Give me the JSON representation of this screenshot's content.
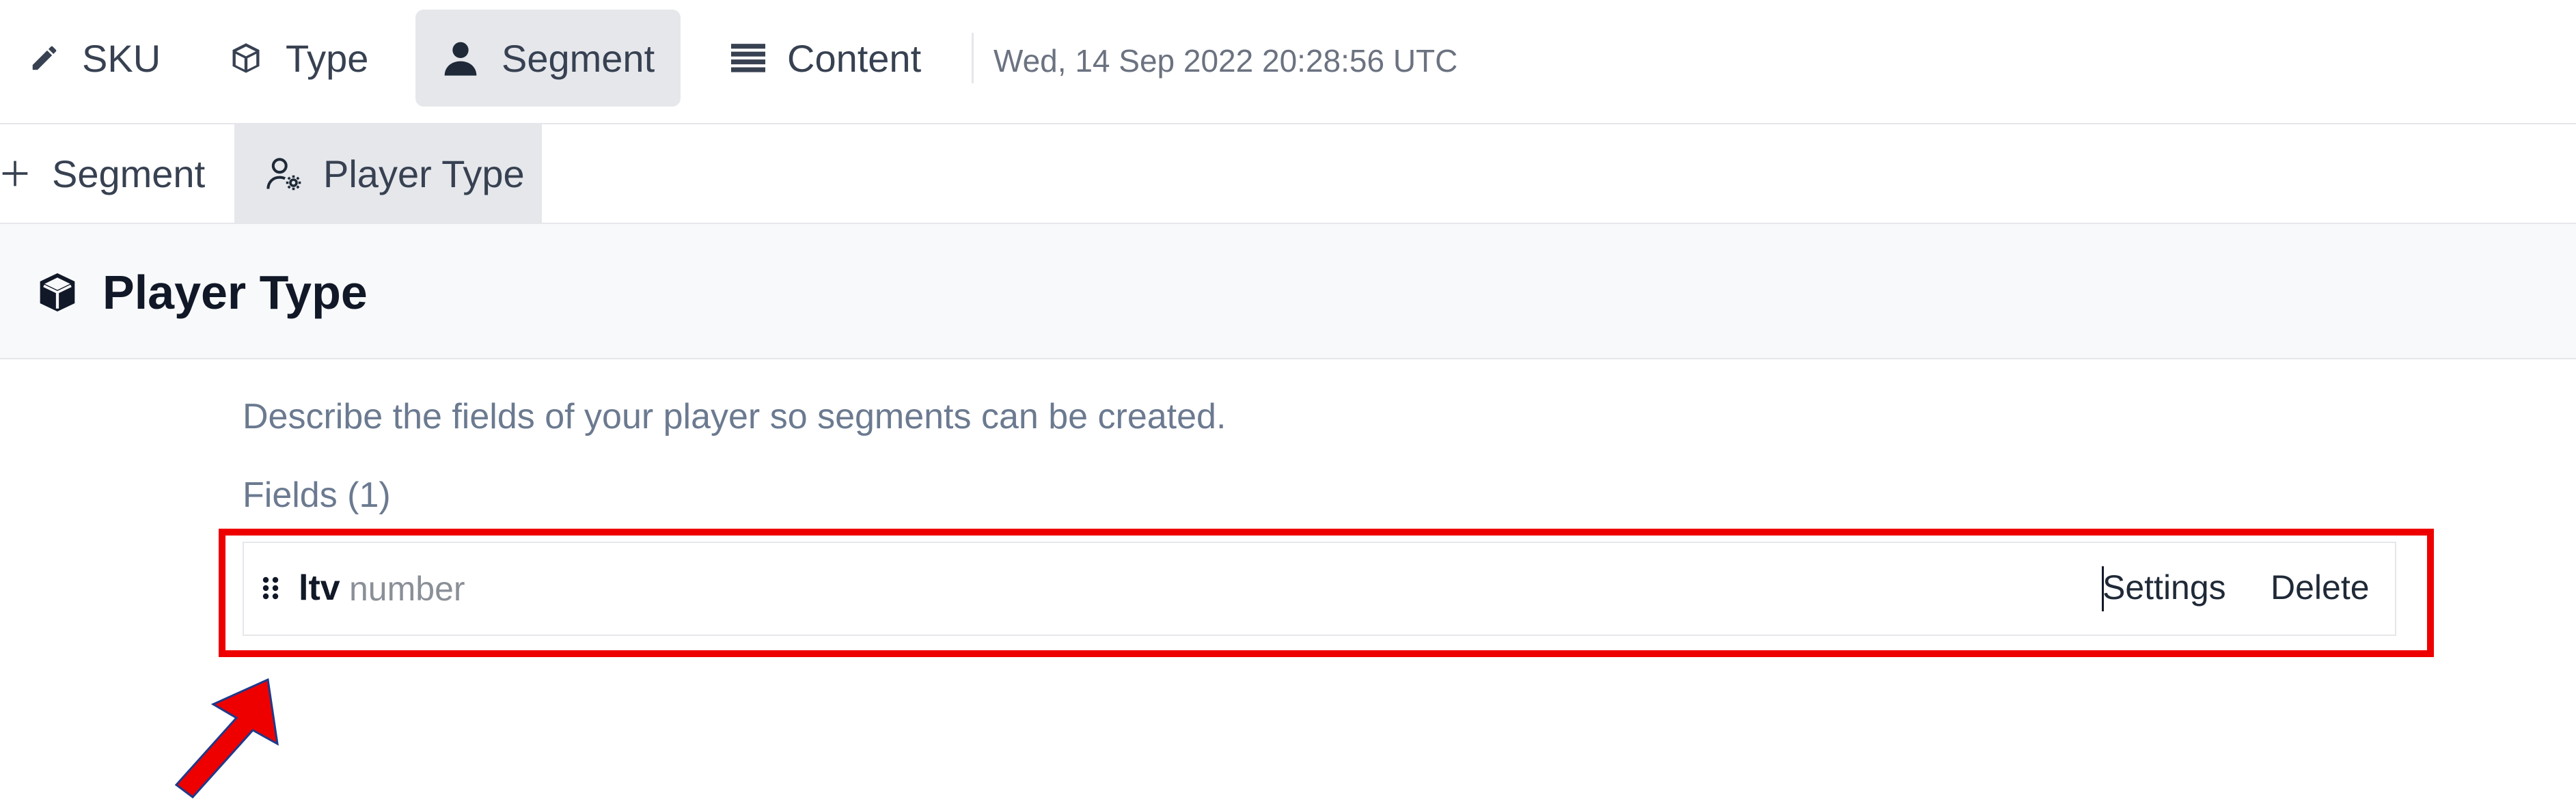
{
  "top_nav": {
    "tabs": [
      {
        "label": "SKU",
        "icon": "pencil-icon",
        "active": false
      },
      {
        "label": "Type",
        "icon": "cube-icon",
        "active": false
      },
      {
        "label": "Segment",
        "icon": "user-icon",
        "active": true
      },
      {
        "label": "Content",
        "icon": "list-icon",
        "active": false
      }
    ],
    "timestamp": "Wed, 14 Sep 2022 20:28:56 UTC"
  },
  "sub_nav": {
    "tabs": [
      {
        "label": "Segment",
        "icon": "plus-icon",
        "active": false
      },
      {
        "label": "Player Type",
        "icon": "user-gear-icon",
        "active": true
      }
    ]
  },
  "page": {
    "title": "Player Type",
    "icon": "cube-icon",
    "description": "Describe the fields of your player so segments can be created.",
    "fields_heading": "Fields (1)",
    "fields": [
      {
        "name": "ltv",
        "type": "number",
        "settings_label": "Settings",
        "delete_label": "Delete"
      }
    ]
  },
  "annotations": {
    "highlight_color": "#ee0000",
    "arrow_color": "#ee0000"
  },
  "colors": {
    "active_tab_bg": "#e5e7eb",
    "muted_text": "#6b7a90",
    "header_bg": "#f8f9fb"
  }
}
